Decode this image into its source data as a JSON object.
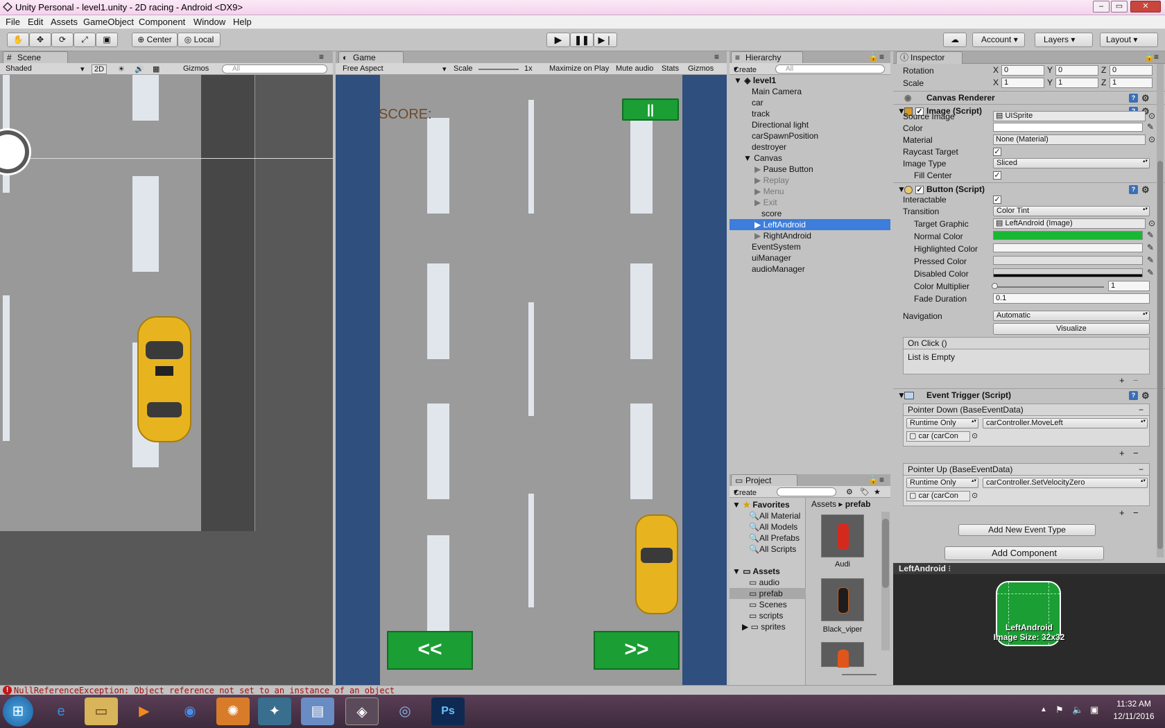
{
  "window": {
    "title": "Unity Personal - level1.unity - 2D racing - Android <DX9>",
    "min": "‒",
    "max": "▭",
    "close": "✕"
  },
  "menu": [
    "File",
    "Edit",
    "Assets",
    "GameObject",
    "Component",
    "Window",
    "Help"
  ],
  "toolbar": {
    "tools": [
      "hand-tool",
      "move-tool",
      "rotate-tool",
      "scale-tool",
      "rect-tool"
    ],
    "pivot": "Center",
    "space": "Local",
    "account": "Account",
    "layers": "Layers",
    "layout": "Layout"
  },
  "scene": {
    "tab": "Scene",
    "shading": "Shaded",
    "mode2d": "2D",
    "gizmos": "Gizmos",
    "search": "All"
  },
  "game": {
    "tab": "Game",
    "aspect": "Free Aspect",
    "scale_label": "Scale",
    "scale_value": "1x",
    "maximize": "Maximize on Play",
    "mute": "Mute audio",
    "stats": "Stats",
    "gizmos": "Gizmos",
    "score_label": "SCORE:",
    "pause_label": "||",
    "left_label": "<<",
    "right_label": ">>"
  },
  "hierarchy": {
    "tab": "Hierarchy",
    "create": "Create",
    "search": "All",
    "scene_name": "level1",
    "items": [
      {
        "label": "Main Camera"
      },
      {
        "label": "car"
      },
      {
        "label": "track"
      },
      {
        "label": "Directional light"
      },
      {
        "label": "carSpawnPosition"
      },
      {
        "label": "destroyer"
      },
      {
        "label": "Canvas"
      },
      {
        "label": "Pause Button"
      },
      {
        "label": "Replay"
      },
      {
        "label": "Menu"
      },
      {
        "label": "Exit"
      },
      {
        "label": "score"
      },
      {
        "label": "LeftAndroid"
      },
      {
        "label": "RightAndroid"
      },
      {
        "label": "EventSystem"
      },
      {
        "label": "uiManager"
      },
      {
        "label": "audioManager"
      }
    ]
  },
  "project": {
    "tab": "Project",
    "create": "Create",
    "favorites": "Favorites",
    "fav_items": [
      "All Material",
      "All Models",
      "All Prefabs",
      "All Scripts"
    ],
    "assets": "Assets",
    "asset_items": [
      "audio",
      "prefab",
      "Scenes",
      "scripts",
      "sprites"
    ],
    "crumb_root": "Assets",
    "crumb_leaf": "prefab",
    "thumbs": [
      "Audi",
      "Black_viper"
    ]
  },
  "inspector": {
    "tab": "Inspector",
    "rotation": {
      "label": "Rotation",
      "x": "0",
      "y": "0",
      "z": "0"
    },
    "scale": {
      "label": "Scale",
      "x": "1",
      "y": "1",
      "z": "1"
    },
    "axis": {
      "x": "X",
      "y": "Y",
      "z": "Z"
    },
    "canvas_renderer": "Canvas Renderer",
    "image": {
      "title": "Image (Script)",
      "source_image_label": "Source Image",
      "source_image": "UISprite",
      "color_label": "Color",
      "material_label": "Material",
      "material": "None (Material)",
      "raycast_label": "Raycast Target",
      "image_type_label": "Image Type",
      "image_type": "Sliced",
      "fill_center_label": "Fill Center"
    },
    "button": {
      "title": "Button (Script)",
      "interactable_label": "Interactable",
      "transition_label": "Transition",
      "transition": "Color Tint",
      "target_graphic_label": "Target Graphic",
      "target_graphic": "LeftAndroid (Image)",
      "normal_label": "Normal Color",
      "normal_color": "#19b733",
      "highlighted_label": "Highlighted Color",
      "pressed_label": "Pressed Color",
      "disabled_label": "Disabled Color",
      "multiplier_label": "Color Multiplier",
      "multiplier": "1",
      "fade_label": "Fade Duration",
      "fade": "0.1",
      "navigation_label": "Navigation",
      "navigation": "Automatic",
      "visualize": "Visualize",
      "onclick_title": "On Click ()",
      "onclick_empty": "List is Empty"
    },
    "event_trigger": {
      "title": "Event Trigger (Script)",
      "entries": [
        {
          "title": "Pointer Down (BaseEventData)",
          "mode": "Runtime Only",
          "func": "carController.MoveLeft",
          "target": "car (carCon"
        },
        {
          "title": "Pointer Up (BaseEventData)",
          "mode": "Runtime Only",
          "func": "carController.SetVelocityZero",
          "target": "car (carCon"
        }
      ],
      "add_event": "Add New Event Type"
    },
    "add_component": "Add Component",
    "preview_title": "LeftAndroid",
    "preview_name": "LeftAndroid",
    "preview_size": "Image Size: 32x32"
  },
  "status": {
    "error": "NullReferenceException: Object reference not set to an instance of an object"
  },
  "taskbar": {
    "time": "11:32 AM",
    "date": "12/11/2016"
  },
  "colors": {
    "selection": "#3d7ddb",
    "green_button": "#1b9e34",
    "road": "#9b9b9b",
    "border_blue": "#2f4f7e"
  }
}
